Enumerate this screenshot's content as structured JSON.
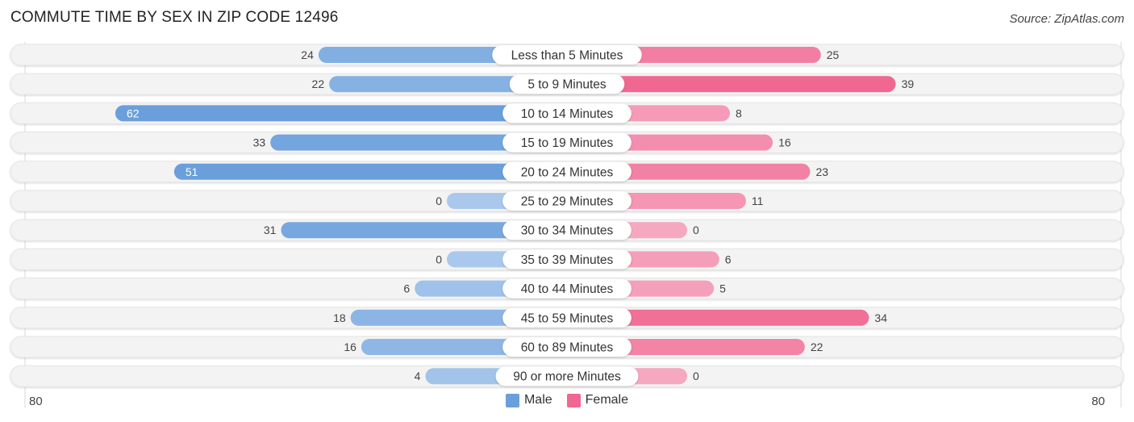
{
  "header": {
    "title": "COMMUTE TIME BY SEX IN ZIP CODE 12496",
    "source": "Source: ZipAtlas.com"
  },
  "legend": {
    "male_label": "Male",
    "female_label": "Female"
  },
  "axis": {
    "left_label": "80",
    "right_label": "80"
  },
  "colors": {
    "male": "#6a9fdc",
    "male_light": "#a9c8ec",
    "female": "#f06892",
    "female_light": "#f6a8c1",
    "row_bg": "#f3f3f3"
  },
  "chart_data": {
    "type": "bar",
    "orientation": "horizontal-diverging",
    "title": "COMMUTE TIME BY SEX IN ZIP CODE 12496",
    "xlim": [
      -80,
      80
    ],
    "categories": [
      "Less than 5 Minutes",
      "5 to 9 Minutes",
      "10 to 14 Minutes",
      "15 to 19 Minutes",
      "20 to 24 Minutes",
      "25 to 29 Minutes",
      "30 to 34 Minutes",
      "35 to 39 Minutes",
      "40 to 44 Minutes",
      "45 to 59 Minutes",
      "60 to 89 Minutes",
      "90 or more Minutes"
    ],
    "series": [
      {
        "name": "Male",
        "values": [
          24,
          22,
          62,
          33,
          51,
          0,
          31,
          0,
          6,
          18,
          16,
          4
        ]
      },
      {
        "name": "Female",
        "values": [
          25,
          39,
          8,
          16,
          23,
          11,
          0,
          6,
          5,
          34,
          22,
          0
        ]
      }
    ],
    "legend_position": "bottom-center"
  }
}
